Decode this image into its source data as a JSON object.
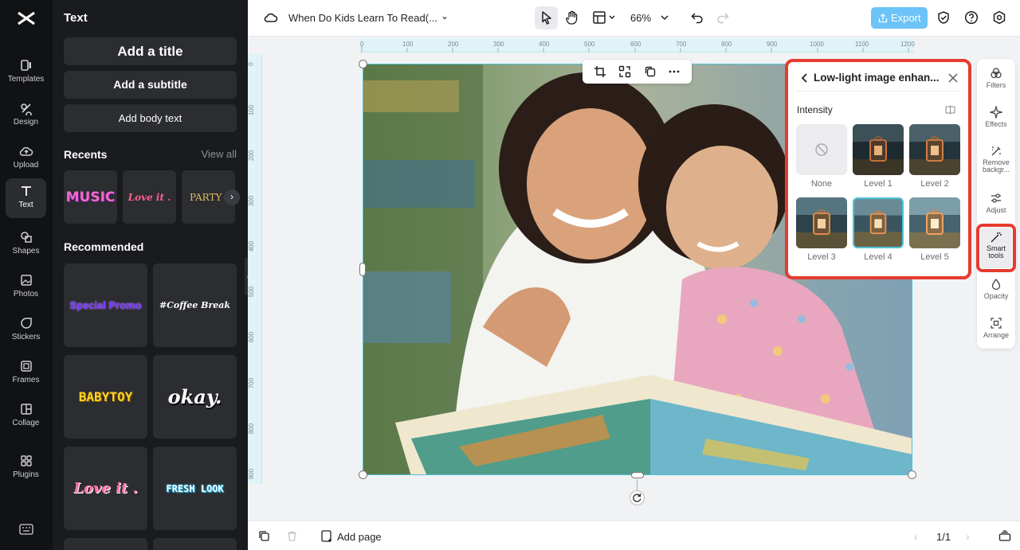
{
  "app": {
    "project_title": "When Do Kids Learn To Read(...",
    "zoom": "66%",
    "export_label": "Export"
  },
  "rail": [
    {
      "label": "Templates",
      "icon": "templates-icon"
    },
    {
      "label": "Design",
      "icon": "design-icon"
    },
    {
      "label": "Upload",
      "icon": "upload-icon"
    },
    {
      "label": "Text",
      "icon": "text-icon"
    },
    {
      "label": "Shapes",
      "icon": "shapes-icon"
    },
    {
      "label": "Photos",
      "icon": "photos-icon"
    },
    {
      "label": "Stickers",
      "icon": "stickers-icon"
    },
    {
      "label": "Frames",
      "icon": "frames-icon"
    },
    {
      "label": "Collage",
      "icon": "collage-icon"
    },
    {
      "label": "Plugins",
      "icon": "plugins-icon"
    }
  ],
  "panel": {
    "title": "Text",
    "add_title": "Add a title",
    "add_subtitle": "Add a subtitle",
    "add_body": "Add body text",
    "recents_label": "Recents",
    "view_all": "View all",
    "recents": [
      "MUSIC",
      "Love it .",
      "PARTY TODAY"
    ],
    "recommended_label": "Recommended",
    "recommended": [
      "Special Promo",
      "#Coffee Break",
      "BABYTOY",
      "okay.",
      "Love it .",
      "FRESH LOOK"
    ]
  },
  "ruler": {
    "h": [
      "0",
      "100",
      "200",
      "300",
      "400",
      "500",
      "600",
      "700",
      "800",
      "900",
      "1000",
      "1100",
      "1200"
    ],
    "v": [
      "0",
      "100",
      "200",
      "300",
      "400",
      "500",
      "600",
      "700",
      "800",
      "900"
    ]
  },
  "enhance": {
    "title": "Low-light image enhan...",
    "intensity_label": "Intensity",
    "levels": [
      "None",
      "Level 1",
      "Level 2",
      "Level 3",
      "Level 4",
      "Level 5"
    ],
    "selected": "Level 4"
  },
  "tools": [
    "Filters",
    "Effects",
    "Remove backgr...",
    "Adjust",
    "Smart tools",
    "Opacity",
    "Arrange"
  ],
  "bottom": {
    "add_page": "Add page",
    "page_counter": "1/1"
  },
  "colors": {
    "accent": "#3fa9f5",
    "highlight": "#e63b2e",
    "selection": "#4fc3d9"
  }
}
